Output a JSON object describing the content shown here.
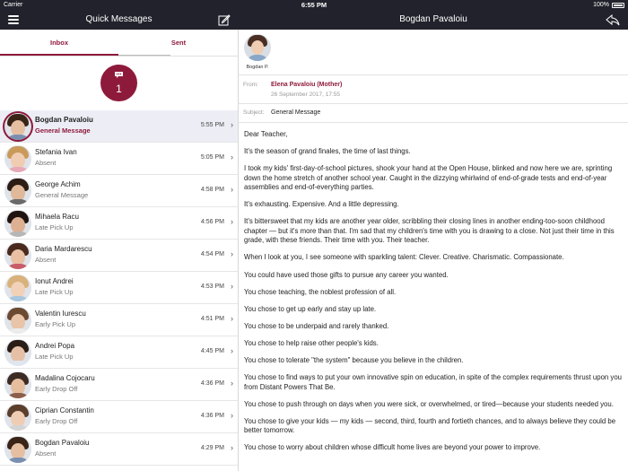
{
  "status": {
    "carrier": "Carrier",
    "time": "6:55 PM",
    "battery": "100%"
  },
  "nav": {
    "left_title": "Quick Messages",
    "right_title": "Bogdan Pavaloiu",
    "menu_icon": "menu-icon",
    "compose_icon": "compose-icon",
    "reply_icon": "reply-icon"
  },
  "tabs": {
    "inbox": "Inbox",
    "sent": "Sent"
  },
  "badge": {
    "count": "1",
    "icon": "chat-bubble-icon"
  },
  "accent_color": "#8e1a3b",
  "messages": [
    {
      "name": "Bogdan Pavaloiu",
      "subject": "General Message",
      "time": "5:55 PM",
      "selected": true
    },
    {
      "name": "Stefania Ivan",
      "subject": "Absent",
      "time": "5:05 PM"
    },
    {
      "name": "George Achim",
      "subject": "General Message",
      "time": "4:58 PM"
    },
    {
      "name": "Mihaela Racu",
      "subject": "Late Pick Up",
      "time": "4:56 PM"
    },
    {
      "name": "Daria Mardarescu",
      "subject": "Absent",
      "time": "4:54 PM"
    },
    {
      "name": "Ionut Andrei",
      "subject": "Late Pick Up",
      "time": "4:53 PM"
    },
    {
      "name": "Valentin Iurescu",
      "subject": "Early Pick Up",
      "time": "4:51 PM"
    },
    {
      "name": "Andrei Popa",
      "subject": "Late Pick Up",
      "time": "4:45 PM"
    },
    {
      "name": "Madalina Cojocaru",
      "subject": "Early Drop Off",
      "time": "4:36 PM"
    },
    {
      "name": "Ciprian Constantin",
      "subject": "Early Drop Off",
      "time": "4:36 PM"
    },
    {
      "name": "Bogdan Pavaloiu",
      "subject": "Absent",
      "time": "4:29 PM"
    }
  ],
  "detail": {
    "sender_label": "Bogdan P.",
    "from_label": "From:",
    "from_name": "Elena Pavaloiu (Mother)",
    "from_date": "26 September 2017, 17:55",
    "subject_label": "Subject:",
    "subject": "General Message",
    "body": [
      "Dear Teacher,",
      "It's the season of grand finales, the time of last things.",
      "I took my kids' first-day-of-school pictures, shook your hand at the Open House, blinked and now here we are, sprinting down the home stretch of another school year. Caught in the dizzying whirlwind of end-of-grade tests and end-of-year assemblies and end-of-everything parties.",
      "It's exhausting. Expensive. And a little depressing.",
      "It's bittersweet that my kids are another year older, scribbling their closing lines in another ending-too-soon childhood chapter — but it's more than that. I'm sad that my children's time with you is drawing to a close. Not just their time in this grade, with these friends. Their time with you. Their teacher.",
      "When I look at you, I see someone with sparkling talent: Clever. Creative. Charismatic. Compassionate.",
      "You could have used those gifts to pursue any career you wanted.",
      "You chose teaching, the noblest profession of all.",
      "You chose to get up early and stay up late.",
      "You chose to be underpaid and rarely thanked.",
      "You chose to help raise other people's kids.",
      "You chose to tolerate \"the system\" because you believe in the children.",
      "You chose to find ways to put your own innovative spin on education, in spite of the complex requirements thrust upon you from Distant Powers That Be.",
      "You chose to push through on days when you were sick, or overwhelmed, or tired—because your students needed you.",
      "You chose to give your kids — my kids — second, third, fourth and fortieth chances, and to always believe they could be better tomorrow.",
      "You chose to worry about children whose difficult home lives are beyond your power to improve."
    ]
  }
}
